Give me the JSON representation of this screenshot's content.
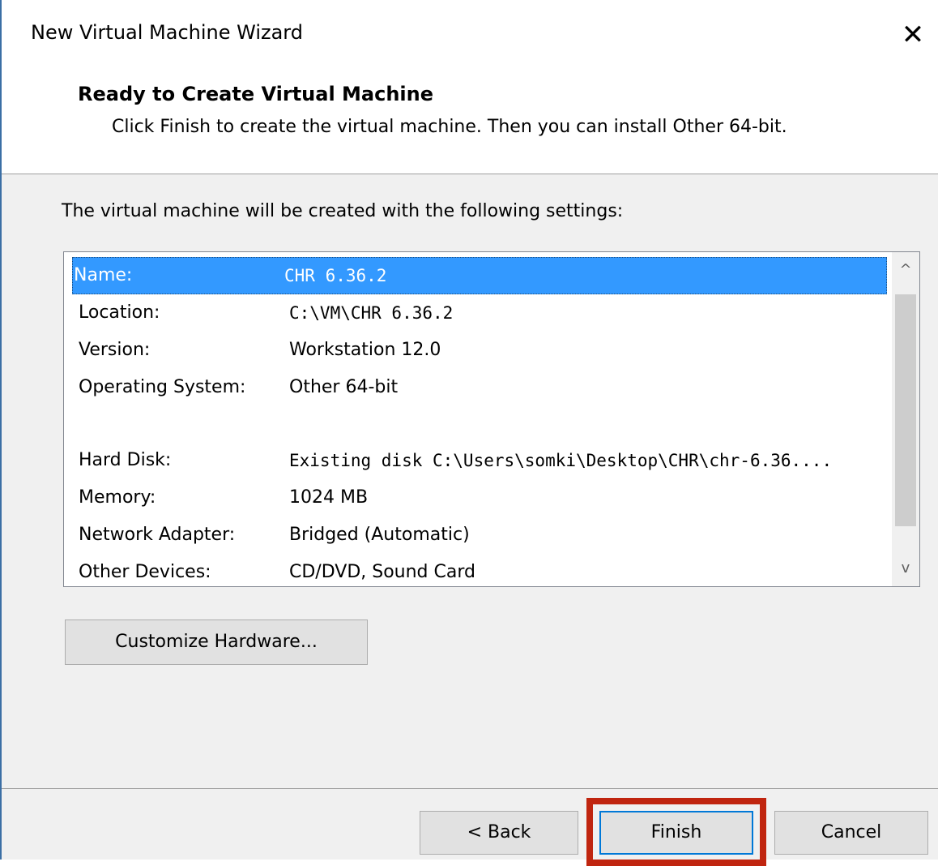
{
  "window": {
    "title": "New Virtual Machine Wizard",
    "close_symbol": "✕"
  },
  "header": {
    "title": "Ready to Create Virtual Machine",
    "description": "Click Finish to create the virtual machine. Then you can install Other 64-bit."
  },
  "intro": "The virtual machine will be created with the following settings:",
  "settings": [
    {
      "label": "Name:",
      "value": "CHR 6.36.2"
    },
    {
      "label": "Location:",
      "value": "C:\\VM\\CHR 6.36.2"
    },
    {
      "label": "Version:",
      "value": "Workstation 12.0"
    },
    {
      "label": "Operating System:",
      "value": "Other 64-bit"
    },
    {
      "label": "Hard Disk:",
      "value": "Existing disk C:\\Users\\somki\\Desktop\\CHR\\chr-6.36...."
    },
    {
      "label": "Memory:",
      "value": "1024 MB"
    },
    {
      "label": "Network Adapter:",
      "value": "Bridged (Automatic)"
    },
    {
      "label": "Other Devices:",
      "value": "CD/DVD, Sound Card"
    }
  ],
  "scrollbar": {
    "up_symbol": "^",
    "down_symbol": "v"
  },
  "buttons": {
    "customize": "Customize Hardware...",
    "back": "< Back",
    "finish": "Finish",
    "cancel": "Cancel"
  },
  "colors": {
    "selection": "#3399ff",
    "highlight_box": "#c0250f",
    "default_button_border": "#0078d7"
  }
}
